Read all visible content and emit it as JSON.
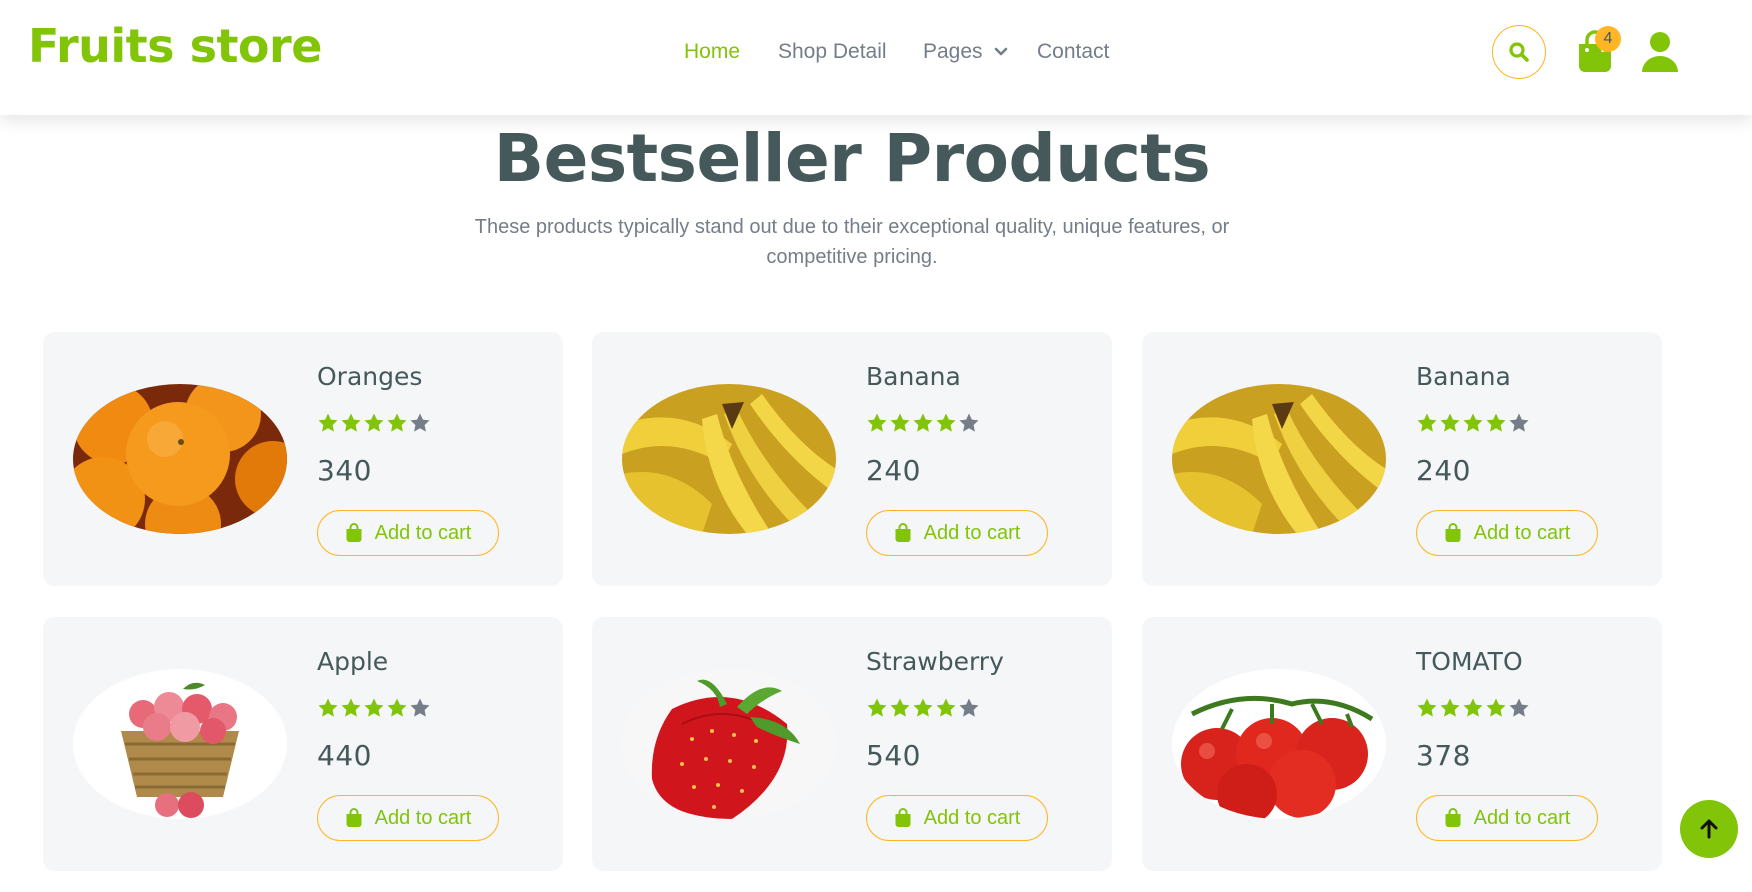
{
  "brand": {
    "logo_text": "Fruits store",
    "accent_color": "#81c408",
    "secondary_color": "#ffb524"
  },
  "nav": {
    "items": [
      {
        "label": "Home",
        "active": true
      },
      {
        "label": "Shop Detail",
        "active": false
      },
      {
        "label": "Pages",
        "has_dropdown": true,
        "active": false
      },
      {
        "label": "Contact",
        "active": false
      }
    ]
  },
  "header_actions": {
    "search_icon": "search-icon",
    "cart_icon": "shopping-bag-icon",
    "cart_count": "4",
    "user_icon": "user-icon"
  },
  "section": {
    "title": "Bestseller Products",
    "description": "These products typically stand out due to their exceptional quality, unique features, or competitive pricing."
  },
  "products": [
    {
      "name": "Oranges",
      "rating": 4,
      "max_rating": 5,
      "price": "340",
      "image": "oranges",
      "button": "Add to cart"
    },
    {
      "name": "Banana",
      "rating": 4,
      "max_rating": 5,
      "price": "240",
      "image": "bananas",
      "button": "Add to cart"
    },
    {
      "name": "Banana",
      "rating": 4,
      "max_rating": 5,
      "price": "240",
      "image": "bananas",
      "button": "Add to cart"
    },
    {
      "name": "Apple",
      "rating": 4,
      "max_rating": 5,
      "price": "440",
      "image": "apples",
      "button": "Add to cart"
    },
    {
      "name": "Strawberry",
      "rating": 4,
      "max_rating": 5,
      "price": "540",
      "image": "strawberry",
      "button": "Add to cart"
    },
    {
      "name": "TOMATO",
      "rating": 4,
      "max_rating": 5,
      "price": "378",
      "image": "tomatoes",
      "button": "Add to cart"
    }
  ],
  "back_to_top_icon": "arrow-up-icon"
}
